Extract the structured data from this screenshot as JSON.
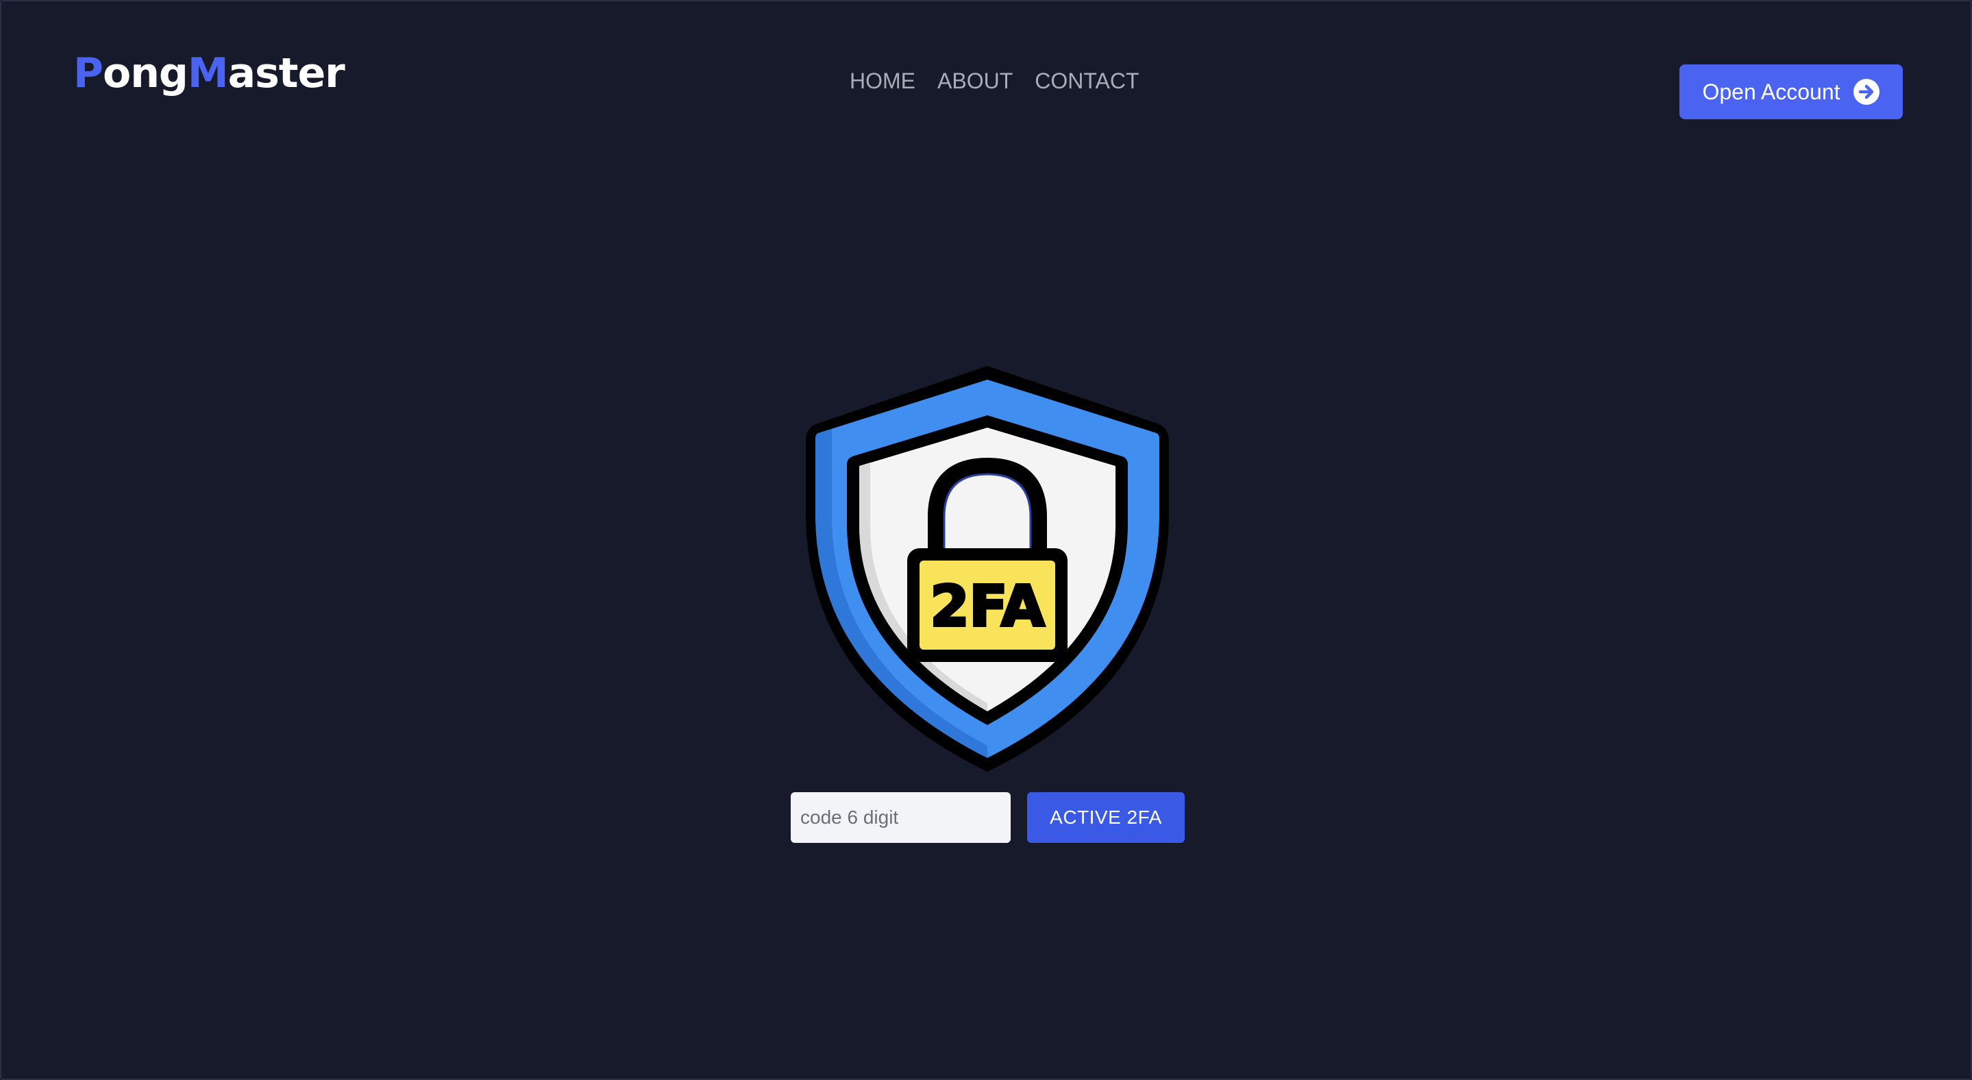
{
  "brand": {
    "first_initial": "P",
    "first_rest": "ong",
    "second_initial": "M",
    "second_rest": "aster",
    "accent_color": "#4a63f0"
  },
  "nav": {
    "items": [
      {
        "label": "HOME"
      },
      {
        "label": "ABOUT"
      },
      {
        "label": "CONTACT"
      }
    ]
  },
  "header": {
    "open_account_label": "Open Account",
    "open_account_icon": "arrow-right-circle-icon"
  },
  "hero": {
    "illustration": "shield-lock-2fa-icon",
    "badge_text": "2FA",
    "shield_color": "#3f8ef0",
    "badge_color": "#f9e35a"
  },
  "twofa_form": {
    "code_placeholder": "code 6 digit",
    "code_value": "",
    "submit_label": "ACTIVE 2FA"
  },
  "theme": {
    "background": "#161a2b",
    "primary": "#4a63f0"
  }
}
